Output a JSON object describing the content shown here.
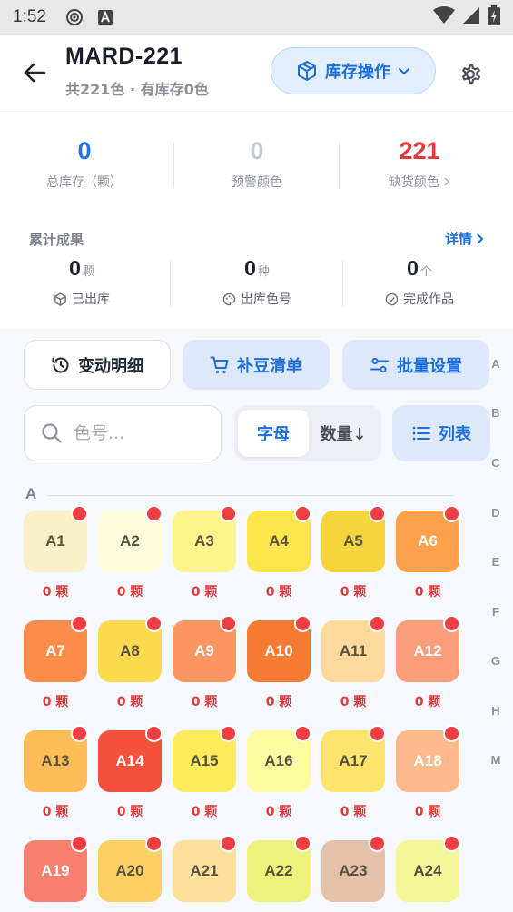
{
  "statusbar": {
    "time": "1:52"
  },
  "header": {
    "title": "MARD-221",
    "subtitle": "共221色 · 有库存0色",
    "stock_op_label": "库存操作"
  },
  "stats": [
    {
      "value": "0",
      "label": "总库存（颗）",
      "color": "#1d74e6"
    },
    {
      "value": "0",
      "label": "预警颜色",
      "color": "#c7ccd4"
    },
    {
      "value": "221",
      "label": "缺货颜色",
      "color": "#e5383d"
    }
  ],
  "cumulative": {
    "title": "累计成果",
    "detail_label": "详情",
    "items": [
      {
        "value": "0",
        "unit": "颗",
        "label": "已出库"
      },
      {
        "value": "0",
        "unit": "种",
        "label": "出库色号"
      },
      {
        "value": "0",
        "unit": "个",
        "label": "完成作品"
      }
    ]
  },
  "actions": {
    "history_label": "变动明细",
    "refill_label": "补豆清单",
    "batch_label": "批量设置"
  },
  "search": {
    "placeholder": "色号..."
  },
  "sort": {
    "active_label": "字母",
    "inactive_label": "数量↓"
  },
  "view": {
    "list_label": "列表"
  },
  "alpha_index": [
    "A",
    "B",
    "C",
    "D",
    "E",
    "F",
    "G",
    "H",
    "M"
  ],
  "group": {
    "letter": "A"
  },
  "colors": [
    {
      "code": "A1",
      "count": "0 颗",
      "bg": "#faf0c8",
      "fg": "#5a5140"
    },
    {
      "code": "A2",
      "count": "0 颗",
      "bg": "#fdfbd9",
      "fg": "#5a5140"
    },
    {
      "code": "A3",
      "count": "0 颗",
      "bg": "#fdf38a",
      "fg": "#5a5140"
    },
    {
      "code": "A4",
      "count": "0 颗",
      "bg": "#fbe64b",
      "fg": "#5a5140"
    },
    {
      "code": "A5",
      "count": "0 颗",
      "bg": "#f4d53b",
      "fg": "#5a5140"
    },
    {
      "code": "A6",
      "count": "0 颗",
      "bg": "#fda04c",
      "fg": "#ffffff"
    },
    {
      "code": "A7",
      "count": "0 颗",
      "bg": "#fd8c4a",
      "fg": "#ffffff"
    },
    {
      "code": "A8",
      "count": "0 颗",
      "bg": "#fdd94e",
      "fg": "#5a5140"
    },
    {
      "code": "A9",
      "count": "0 颗",
      "bg": "#fc9661",
      "fg": "#ffffff"
    },
    {
      "code": "A10",
      "count": "0 颗",
      "bg": "#f57b33",
      "fg": "#ffffff"
    },
    {
      "code": "A11",
      "count": "0 颗",
      "bg": "#fdd99b",
      "fg": "#5a5140"
    },
    {
      "code": "A12",
      "count": "0 颗",
      "bg": "#fc9d7a",
      "fg": "#ffffff"
    },
    {
      "code": "A13",
      "count": "0 颗",
      "bg": "#fcbd59",
      "fg": "#5a5140"
    },
    {
      "code": "A14",
      "count": "0 颗",
      "bg": "#f5503c",
      "fg": "#ffffff"
    },
    {
      "code": "A15",
      "count": "0 颗",
      "bg": "#fdeb5b",
      "fg": "#5a5140"
    },
    {
      "code": "A16",
      "count": "0 颗",
      "bg": "#fdfb9f",
      "fg": "#5a5140"
    },
    {
      "code": "A17",
      "count": "0 颗",
      "bg": "#fde46c",
      "fg": "#5a5140"
    },
    {
      "code": "A18",
      "count": "0 颗",
      "bg": "#fcb98a",
      "fg": "#ffffff"
    },
    {
      "code": "A19",
      "count": "",
      "bg": "#f9806e",
      "fg": "#ffffff"
    },
    {
      "code": "A20",
      "count": "",
      "bg": "#fdd064",
      "fg": "#5a5140"
    },
    {
      "code": "A21",
      "count": "",
      "bg": "#fee09a",
      "fg": "#5a5140"
    },
    {
      "code": "A22",
      "count": "",
      "bg": "#eef27a",
      "fg": "#5a5140"
    },
    {
      "code": "A23",
      "count": "",
      "bg": "#e4c1a9",
      "fg": "#5a5140"
    },
    {
      "code": "A24",
      "count": "",
      "bg": "#f4f69a",
      "fg": "#5a5140"
    }
  ]
}
